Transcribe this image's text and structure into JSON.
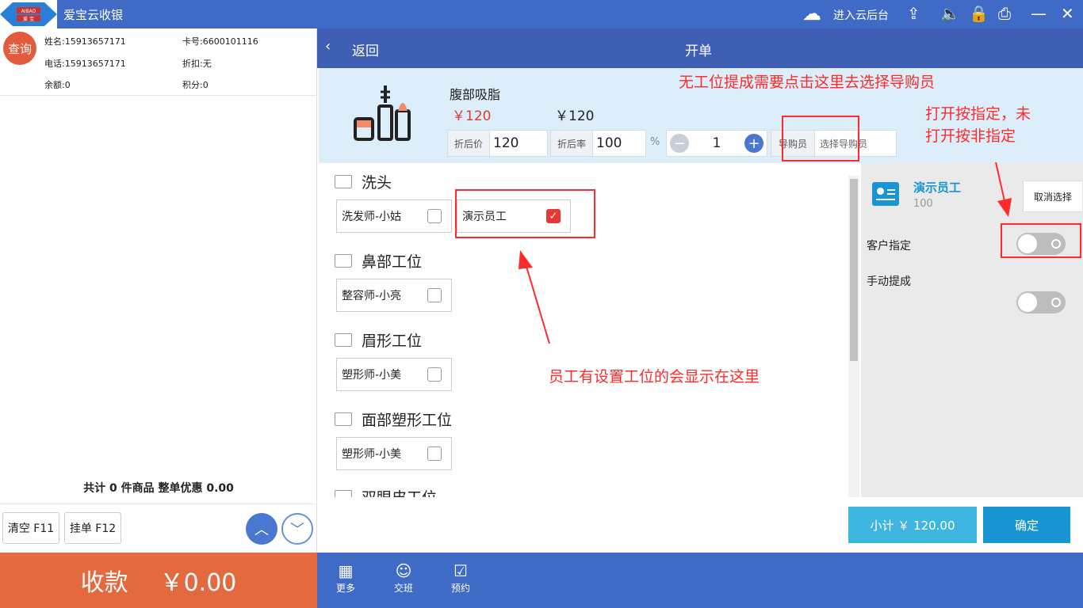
{
  "app": {
    "title": "爱宝云收银",
    "logo_top": "AIBAO",
    "logo_bottom": "爱 宝",
    "cloud_label": "进入云后台"
  },
  "member": {
    "query": "查询",
    "name": "姓名:15913657171",
    "card": "卡号:6600101116",
    "phone": "电话:15913657171",
    "discount": "折扣:无",
    "balance": "余额:0",
    "points": "积分:0"
  },
  "cart": {
    "total": "共计 0 件商品 整单优惠 0.00",
    "clear": "清空 F11",
    "hold": "挂单 F12",
    "pay": "收款",
    "pay_amount": "￥0.00"
  },
  "header": {
    "back": "返回",
    "title": "开单"
  },
  "product": {
    "name": "腹部吸脂",
    "price_red": "￥120",
    "price": "￥120",
    "after_price_label": "折后价",
    "after_price": "120",
    "rate_label": "折后率",
    "rate": "100",
    "percent": "%",
    "qty": "1",
    "guide_label": "导购员",
    "guide_placeholder": "选择导购员"
  },
  "groups": [
    {
      "title": "洗头",
      "chips": [
        {
          "label": "洗发师-小姑",
          "checked": false
        },
        {
          "label": "演示员工",
          "checked": true
        }
      ]
    },
    {
      "title": "鼻部工位",
      "chips": [
        {
          "label": "整容师-小亮",
          "checked": false
        }
      ]
    },
    {
      "title": "眉形工位",
      "chips": [
        {
          "label": "塑形师-小美",
          "checked": false
        }
      ]
    },
    {
      "title": "面部塑形工位",
      "chips": [
        {
          "label": "塑形师-小美",
          "checked": false
        }
      ]
    },
    {
      "title": "双眼皮工位"
    }
  ],
  "selected": {
    "name": "演示员工",
    "value": "100",
    "cancel": "取消选择",
    "customer_assign": "客户指定",
    "manual_commission": "手动提成"
  },
  "annotations": {
    "top": "无工位提成需要点击这里去选择导购员",
    "right_line1": "打开按指定，未",
    "right_line2": "打开按非指定",
    "middle": "员工有设置工位的会显示在这里"
  },
  "footer": {
    "subtotal": "小计 ￥ 120.00",
    "confirm": "确定",
    "more": "更多",
    "shift": "交班",
    "booking": "预约"
  },
  "colors": {
    "primary": "#3f6bc7",
    "pay": "#e26a3e",
    "annotation": "#ff2a2a",
    "checked": "#e53935"
  }
}
